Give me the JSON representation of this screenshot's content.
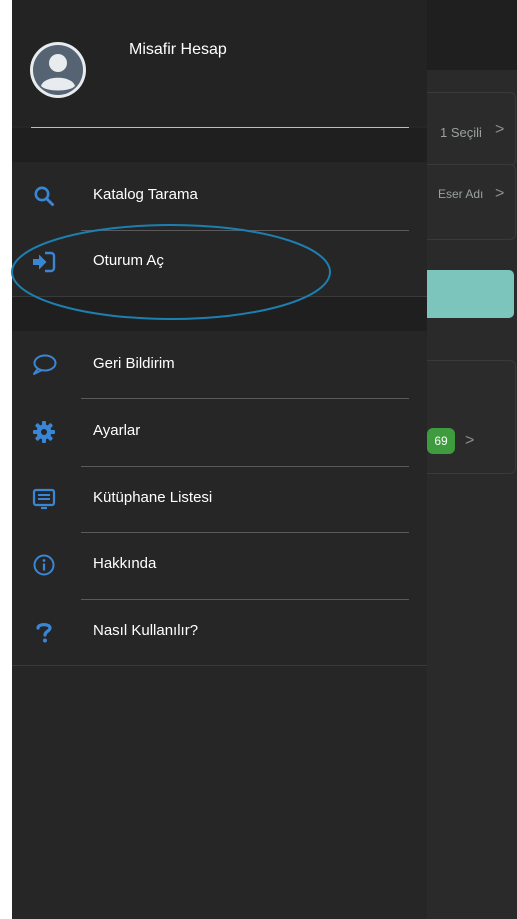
{
  "profile": {
    "name": "Misafir Hesap"
  },
  "menu": {
    "items": [
      {
        "label": "Katalog Tarama",
        "icon": "search-icon"
      },
      {
        "label": "Oturum Aç",
        "icon": "sign-in-icon"
      },
      {
        "label": "Geri Bildirim",
        "icon": "chat-bubble-icon"
      },
      {
        "label": "Ayarlar",
        "icon": "gear-icon"
      },
      {
        "label": "Kütüphane Listesi",
        "icon": "list-icon"
      },
      {
        "label": "Hakkında",
        "icon": "info-icon"
      },
      {
        "label": "Nasıl Kullanılır?",
        "icon": "question-icon"
      }
    ]
  },
  "background": {
    "filter_selected": "1 Seçili",
    "sort_label": "Eser Adı",
    "badge_count": "69"
  },
  "colors": {
    "accent_blue": "#3a86d6",
    "drawer_bg": "#262626",
    "teal_button": "#7bc5bd",
    "badge_green": "#3e9b3e",
    "highlight_ring": "#1d7fb0"
  }
}
